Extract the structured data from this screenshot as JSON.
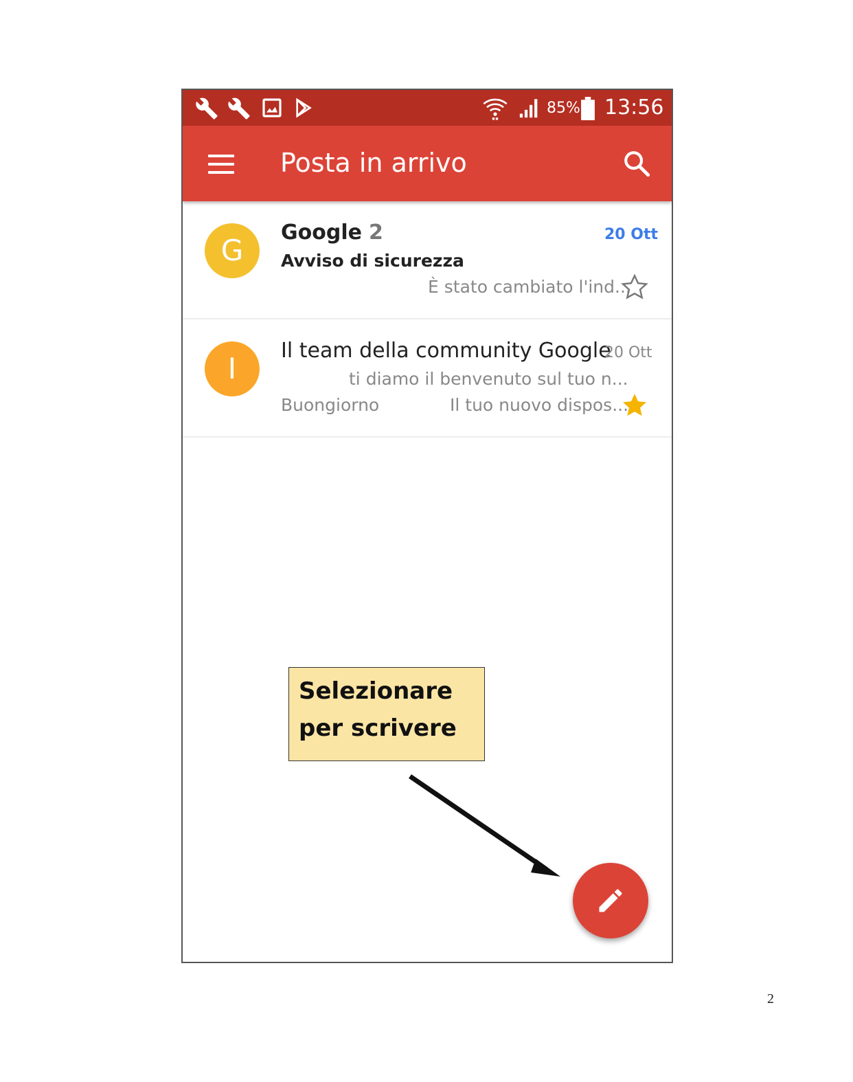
{
  "statusbar": {
    "icons": [
      "wrench-icon",
      "wrench-icon",
      "image-icon",
      "play-store-icon",
      "wifi-icon",
      "signal-icon",
      "battery-icon"
    ],
    "battery": "85%",
    "time": "13:56"
  },
  "appbar": {
    "title": "Posta in arrivo",
    "menu_icon": "menu-icon",
    "search_icon": "search-icon"
  },
  "emails": [
    {
      "avatar_letter": "G",
      "avatar_color": "#f4c02e",
      "sender": "Google",
      "count": "2",
      "date": "20 Ott",
      "date_color": "#3d7ee8",
      "subject": "Avviso di sicurezza",
      "snippet": "È stato cambiato l'ind...",
      "starred": false
    },
    {
      "avatar_letter": "I",
      "avatar_color": "#fba62a",
      "sender": "Il team della community Google",
      "date": "20 Ott",
      "date_color": "#888888",
      "subject_line": "ti diamo il benvenuto sul tuo n...",
      "preview_left": "Buongiorno",
      "snippet": "Il tuo nuovo dispos...",
      "starred": true,
      "star_color": "#f4b400"
    }
  ],
  "compose_button": {
    "icon": "pencil-icon",
    "color": "#dc4337"
  },
  "callout": {
    "line1": "Selezionare",
    "line2": "per scrivere",
    "background": "#fbe5a5"
  },
  "page_number": "2"
}
